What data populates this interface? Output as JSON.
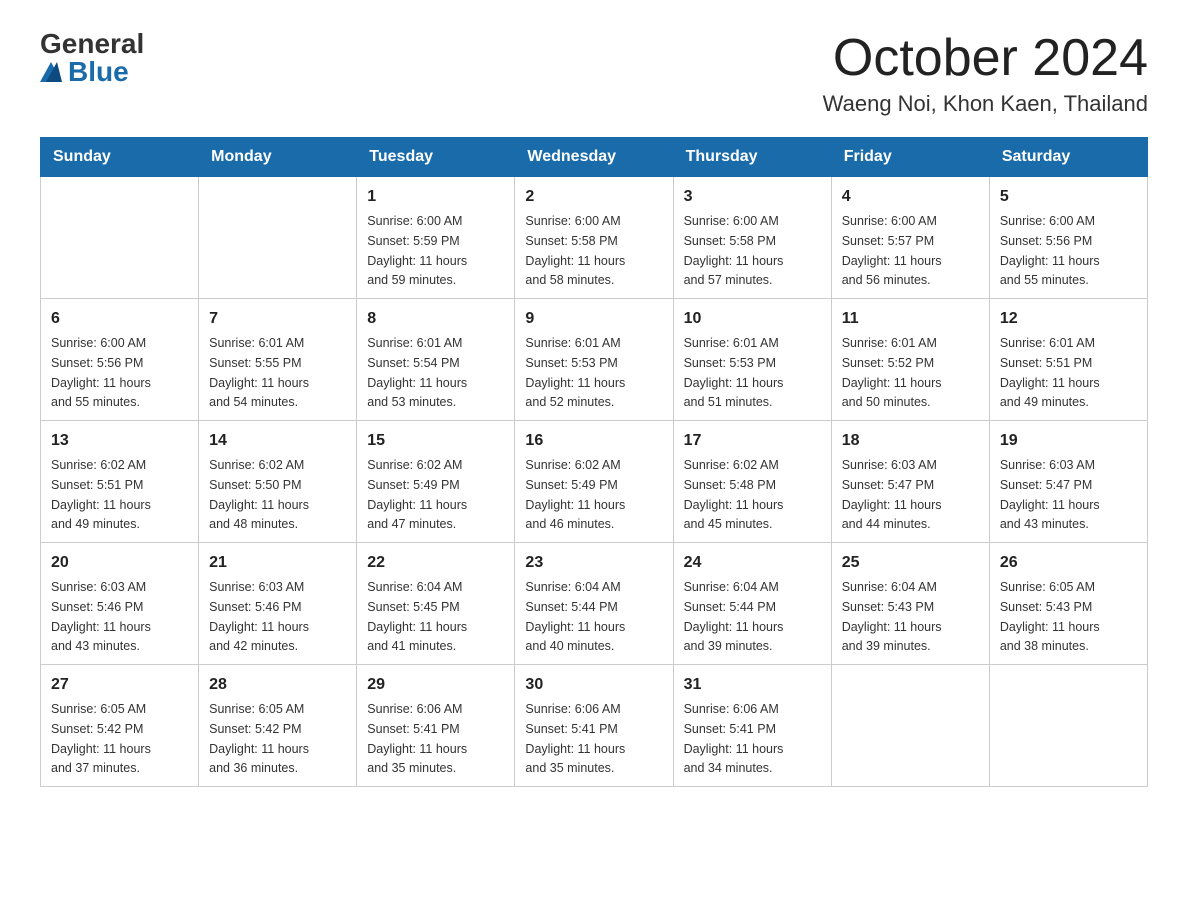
{
  "header": {
    "logo_general": "General",
    "logo_blue": "Blue",
    "month_title": "October 2024",
    "location": "Waeng Noi, Khon Kaen, Thailand"
  },
  "weekdays": [
    "Sunday",
    "Monday",
    "Tuesday",
    "Wednesday",
    "Thursday",
    "Friday",
    "Saturday"
  ],
  "weeks": [
    [
      {
        "day": "",
        "info": ""
      },
      {
        "day": "",
        "info": ""
      },
      {
        "day": "1",
        "info": "Sunrise: 6:00 AM\nSunset: 5:59 PM\nDaylight: 11 hours\nand 59 minutes."
      },
      {
        "day": "2",
        "info": "Sunrise: 6:00 AM\nSunset: 5:58 PM\nDaylight: 11 hours\nand 58 minutes."
      },
      {
        "day": "3",
        "info": "Sunrise: 6:00 AM\nSunset: 5:58 PM\nDaylight: 11 hours\nand 57 minutes."
      },
      {
        "day": "4",
        "info": "Sunrise: 6:00 AM\nSunset: 5:57 PM\nDaylight: 11 hours\nand 56 minutes."
      },
      {
        "day": "5",
        "info": "Sunrise: 6:00 AM\nSunset: 5:56 PM\nDaylight: 11 hours\nand 55 minutes."
      }
    ],
    [
      {
        "day": "6",
        "info": "Sunrise: 6:00 AM\nSunset: 5:56 PM\nDaylight: 11 hours\nand 55 minutes."
      },
      {
        "day": "7",
        "info": "Sunrise: 6:01 AM\nSunset: 5:55 PM\nDaylight: 11 hours\nand 54 minutes."
      },
      {
        "day": "8",
        "info": "Sunrise: 6:01 AM\nSunset: 5:54 PM\nDaylight: 11 hours\nand 53 minutes."
      },
      {
        "day": "9",
        "info": "Sunrise: 6:01 AM\nSunset: 5:53 PM\nDaylight: 11 hours\nand 52 minutes."
      },
      {
        "day": "10",
        "info": "Sunrise: 6:01 AM\nSunset: 5:53 PM\nDaylight: 11 hours\nand 51 minutes."
      },
      {
        "day": "11",
        "info": "Sunrise: 6:01 AM\nSunset: 5:52 PM\nDaylight: 11 hours\nand 50 minutes."
      },
      {
        "day": "12",
        "info": "Sunrise: 6:01 AM\nSunset: 5:51 PM\nDaylight: 11 hours\nand 49 minutes."
      }
    ],
    [
      {
        "day": "13",
        "info": "Sunrise: 6:02 AM\nSunset: 5:51 PM\nDaylight: 11 hours\nand 49 minutes."
      },
      {
        "day": "14",
        "info": "Sunrise: 6:02 AM\nSunset: 5:50 PM\nDaylight: 11 hours\nand 48 minutes."
      },
      {
        "day": "15",
        "info": "Sunrise: 6:02 AM\nSunset: 5:49 PM\nDaylight: 11 hours\nand 47 minutes."
      },
      {
        "day": "16",
        "info": "Sunrise: 6:02 AM\nSunset: 5:49 PM\nDaylight: 11 hours\nand 46 minutes."
      },
      {
        "day": "17",
        "info": "Sunrise: 6:02 AM\nSunset: 5:48 PM\nDaylight: 11 hours\nand 45 minutes."
      },
      {
        "day": "18",
        "info": "Sunrise: 6:03 AM\nSunset: 5:47 PM\nDaylight: 11 hours\nand 44 minutes."
      },
      {
        "day": "19",
        "info": "Sunrise: 6:03 AM\nSunset: 5:47 PM\nDaylight: 11 hours\nand 43 minutes."
      }
    ],
    [
      {
        "day": "20",
        "info": "Sunrise: 6:03 AM\nSunset: 5:46 PM\nDaylight: 11 hours\nand 43 minutes."
      },
      {
        "day": "21",
        "info": "Sunrise: 6:03 AM\nSunset: 5:46 PM\nDaylight: 11 hours\nand 42 minutes."
      },
      {
        "day": "22",
        "info": "Sunrise: 6:04 AM\nSunset: 5:45 PM\nDaylight: 11 hours\nand 41 minutes."
      },
      {
        "day": "23",
        "info": "Sunrise: 6:04 AM\nSunset: 5:44 PM\nDaylight: 11 hours\nand 40 minutes."
      },
      {
        "day": "24",
        "info": "Sunrise: 6:04 AM\nSunset: 5:44 PM\nDaylight: 11 hours\nand 39 minutes."
      },
      {
        "day": "25",
        "info": "Sunrise: 6:04 AM\nSunset: 5:43 PM\nDaylight: 11 hours\nand 39 minutes."
      },
      {
        "day": "26",
        "info": "Sunrise: 6:05 AM\nSunset: 5:43 PM\nDaylight: 11 hours\nand 38 minutes."
      }
    ],
    [
      {
        "day": "27",
        "info": "Sunrise: 6:05 AM\nSunset: 5:42 PM\nDaylight: 11 hours\nand 37 minutes."
      },
      {
        "day": "28",
        "info": "Sunrise: 6:05 AM\nSunset: 5:42 PM\nDaylight: 11 hours\nand 36 minutes."
      },
      {
        "day": "29",
        "info": "Sunrise: 6:06 AM\nSunset: 5:41 PM\nDaylight: 11 hours\nand 35 minutes."
      },
      {
        "day": "30",
        "info": "Sunrise: 6:06 AM\nSunset: 5:41 PM\nDaylight: 11 hours\nand 35 minutes."
      },
      {
        "day": "31",
        "info": "Sunrise: 6:06 AM\nSunset: 5:41 PM\nDaylight: 11 hours\nand 34 minutes."
      },
      {
        "day": "",
        "info": ""
      },
      {
        "day": "",
        "info": ""
      }
    ]
  ]
}
